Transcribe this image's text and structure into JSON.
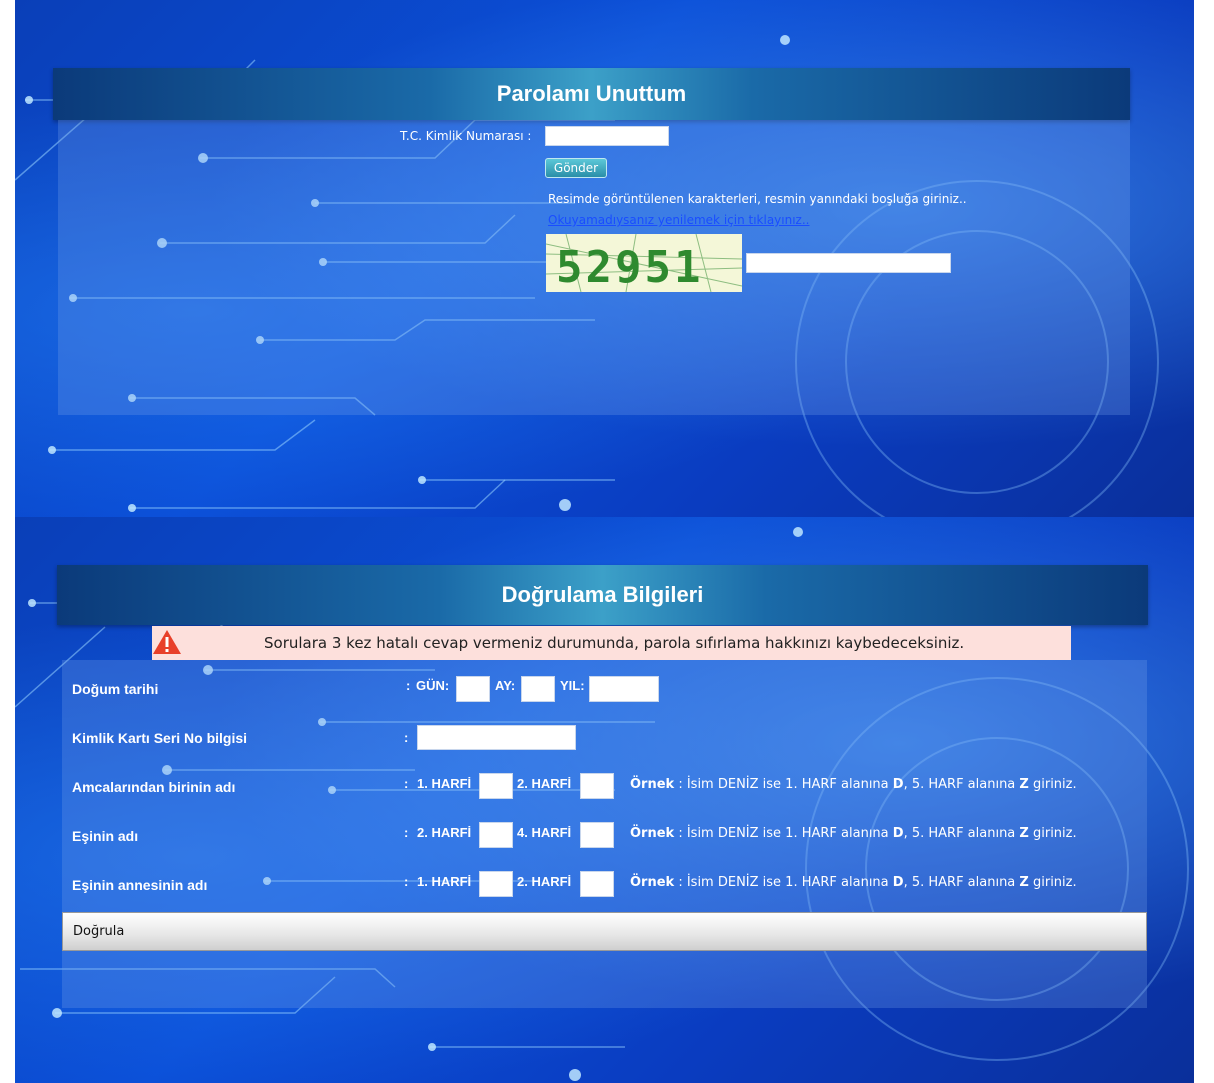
{
  "forgot_password": {
    "title": "Parolamı Unuttum",
    "tc_label": "T.C. Kimlik Numarası :",
    "tc_value": "",
    "send_button": "Gönder",
    "captcha_instruction": "Resimde görüntülenen karakterleri, resmin yanındaki boşluğa giriniz..",
    "captcha_refresh_link": "Okuyamadıysanız yenilemek için tıklayınız..",
    "captcha_text": "52951",
    "captcha_value": ""
  },
  "verification": {
    "title": "Doğrulama Bilgileri",
    "warning": "Sorulara 3 kez hatalı cevap vermeniz durumunda, parola sıfırlama hakkınızı kaybedeceksiniz.",
    "birth_date_label": "Doğum tarihi",
    "day_label": "GÜN:",
    "month_label": "AY:",
    "year_label": "YIL:",
    "id_serial_label": "Kimlik Kartı Seri No bilgisi",
    "rows": [
      {
        "label": "Amcalarından birinin adı",
        "letter1": "1. HARFİ",
        "letter2": "2. HARFİ"
      },
      {
        "label": "Eşinin adı",
        "letter1": "2. HARFİ",
        "letter2": "4. HARFİ"
      },
      {
        "label": "Eşinin annesinin adı",
        "letter1": "1. HARFİ",
        "letter2": "2. HARFİ"
      }
    ],
    "example_bold": "Örnek",
    "example_text_1": " : İsim DENİZ ise 1. HARF alanına ",
    "example_d": "D",
    "example_text_2": ", 5. HARF alanına ",
    "example_z": "Z",
    "example_text_3": " giriniz.",
    "verify_button": "Doğrula"
  }
}
